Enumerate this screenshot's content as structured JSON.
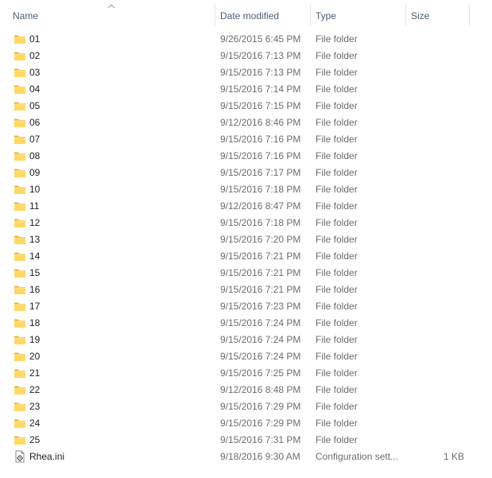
{
  "columns": {
    "name": "Name",
    "date": "Date modified",
    "type": "Type",
    "size": "Size"
  },
  "sort": {
    "column": "name",
    "direction": "ascending",
    "icon": "sort-up-chevron-icon"
  },
  "colors": {
    "header_text": "#4c607a",
    "meta_text": "#6d6d6d",
    "folder_body": "#ffd966",
    "folder_tab": "#e8b441"
  },
  "files": [
    {
      "name": "01",
      "date": "9/26/2015 6:45 PM",
      "type": "File folder",
      "size": "",
      "icon": "folder-icon"
    },
    {
      "name": "02",
      "date": "9/15/2016 7:13 PM",
      "type": "File folder",
      "size": "",
      "icon": "folder-icon"
    },
    {
      "name": "03",
      "date": "9/15/2016 7:13 PM",
      "type": "File folder",
      "size": "",
      "icon": "folder-icon"
    },
    {
      "name": "04",
      "date": "9/15/2016 7:14 PM",
      "type": "File folder",
      "size": "",
      "icon": "folder-icon"
    },
    {
      "name": "05",
      "date": "9/15/2016 7:15 PM",
      "type": "File folder",
      "size": "",
      "icon": "folder-icon"
    },
    {
      "name": "06",
      "date": "9/12/2016 8:46 PM",
      "type": "File folder",
      "size": "",
      "icon": "folder-icon"
    },
    {
      "name": "07",
      "date": "9/15/2016 7:16 PM",
      "type": "File folder",
      "size": "",
      "icon": "folder-icon"
    },
    {
      "name": "08",
      "date": "9/15/2016 7:16 PM",
      "type": "File folder",
      "size": "",
      "icon": "folder-icon"
    },
    {
      "name": "09",
      "date": "9/15/2016 7:17 PM",
      "type": "File folder",
      "size": "",
      "icon": "folder-icon"
    },
    {
      "name": "10",
      "date": "9/15/2016 7:18 PM",
      "type": "File folder",
      "size": "",
      "icon": "folder-icon"
    },
    {
      "name": "11",
      "date": "9/12/2016 8:47 PM",
      "type": "File folder",
      "size": "",
      "icon": "folder-icon"
    },
    {
      "name": "12",
      "date": "9/15/2016 7:18 PM",
      "type": "File folder",
      "size": "",
      "icon": "folder-icon"
    },
    {
      "name": "13",
      "date": "9/15/2016 7:20 PM",
      "type": "File folder",
      "size": "",
      "icon": "folder-icon"
    },
    {
      "name": "14",
      "date": "9/15/2016 7:21 PM",
      "type": "File folder",
      "size": "",
      "icon": "folder-icon"
    },
    {
      "name": "15",
      "date": "9/15/2016 7:21 PM",
      "type": "File folder",
      "size": "",
      "icon": "folder-icon"
    },
    {
      "name": "16",
      "date": "9/15/2016 7:21 PM",
      "type": "File folder",
      "size": "",
      "icon": "folder-icon"
    },
    {
      "name": "17",
      "date": "9/15/2016 7:23 PM",
      "type": "File folder",
      "size": "",
      "icon": "folder-icon"
    },
    {
      "name": "18",
      "date": "9/15/2016 7:24 PM",
      "type": "File folder",
      "size": "",
      "icon": "folder-icon"
    },
    {
      "name": "19",
      "date": "9/15/2016 7:24 PM",
      "type": "File folder",
      "size": "",
      "icon": "folder-icon"
    },
    {
      "name": "20",
      "date": "9/15/2016 7:24 PM",
      "type": "File folder",
      "size": "",
      "icon": "folder-icon"
    },
    {
      "name": "21",
      "date": "9/15/2016 7:25 PM",
      "type": "File folder",
      "size": "",
      "icon": "folder-icon"
    },
    {
      "name": "22",
      "date": "9/12/2016 8:48 PM",
      "type": "File folder",
      "size": "",
      "icon": "folder-icon"
    },
    {
      "name": "23",
      "date": "9/15/2016 7:29 PM",
      "type": "File folder",
      "size": "",
      "icon": "folder-icon"
    },
    {
      "name": "24",
      "date": "9/15/2016 7:29 PM",
      "type": "File folder",
      "size": "",
      "icon": "folder-icon"
    },
    {
      "name": "25",
      "date": "9/15/2016 7:31 PM",
      "type": "File folder",
      "size": "",
      "icon": "folder-icon"
    },
    {
      "name": "Rhea.ini",
      "date": "9/18/2016 9:30 AM",
      "type": "Configuration sett...",
      "size": "1 KB",
      "icon": "config-file-icon"
    }
  ]
}
